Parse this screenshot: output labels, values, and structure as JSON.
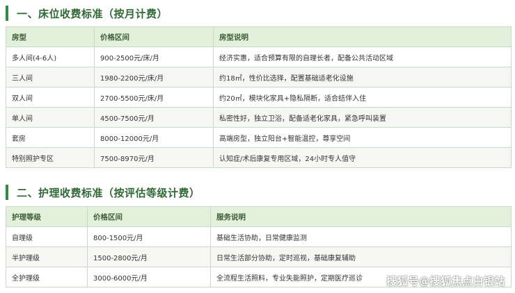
{
  "section1": {
    "title": "一、床位收费标准（按月计费）",
    "headers": [
      "房型",
      "价格区间",
      "房型说明"
    ],
    "rows": [
      [
        "多人间(4-6人)",
        "900-2500元/床/月",
        "经济实惠，适合预算有限的自理长者，配备公共活动区域"
      ],
      [
        "三人间",
        "1980-2200元/床/月",
        "约18㎡，性价比选择，配置基础适老化设施"
      ],
      [
        "双人间",
        "2700-5500元/床/月",
        "约20㎡，模块化家具+隐私隔断，适合结伴入住"
      ],
      [
        "单人间",
        "4500-7500元/月",
        "私密性好，独立卫浴，配备适老化家具，紧急呼叫装置"
      ],
      [
        "套房",
        "8000-12000元/月",
        "高端房型，独立阳台+智能温控，尊享空间"
      ],
      [
        "特别照护专区",
        "7500-8970元/月",
        "认知症/术后康复专用区域，24小时专人值守"
      ]
    ]
  },
  "section2": {
    "title": "二、护理收费标准（按评估等级计费）",
    "headers": [
      "护理等级",
      "价格区间",
      "服务说明"
    ],
    "rows": [
      [
        "自理级",
        "800-1500元/月",
        "基础生活协助，日常健康监测"
      ],
      [
        "半护理级",
        "1500-2800元/月",
        "日常生活部分协助，定时巡视，基础康复辅助"
      ],
      [
        "全护理级",
        "3000-6000元/月",
        "全流程生活照料，专业失能照护，定期医疗巡诊"
      ]
    ]
  },
  "watermark": "搜狐号@搜狐焦点白银站",
  "colors": {
    "accent": "#2f8d3f",
    "heading_text": "#2e6b33",
    "header_bg": "#e3f1dc",
    "border": "#c7dcc4",
    "stripe": "#f6f7f5"
  }
}
